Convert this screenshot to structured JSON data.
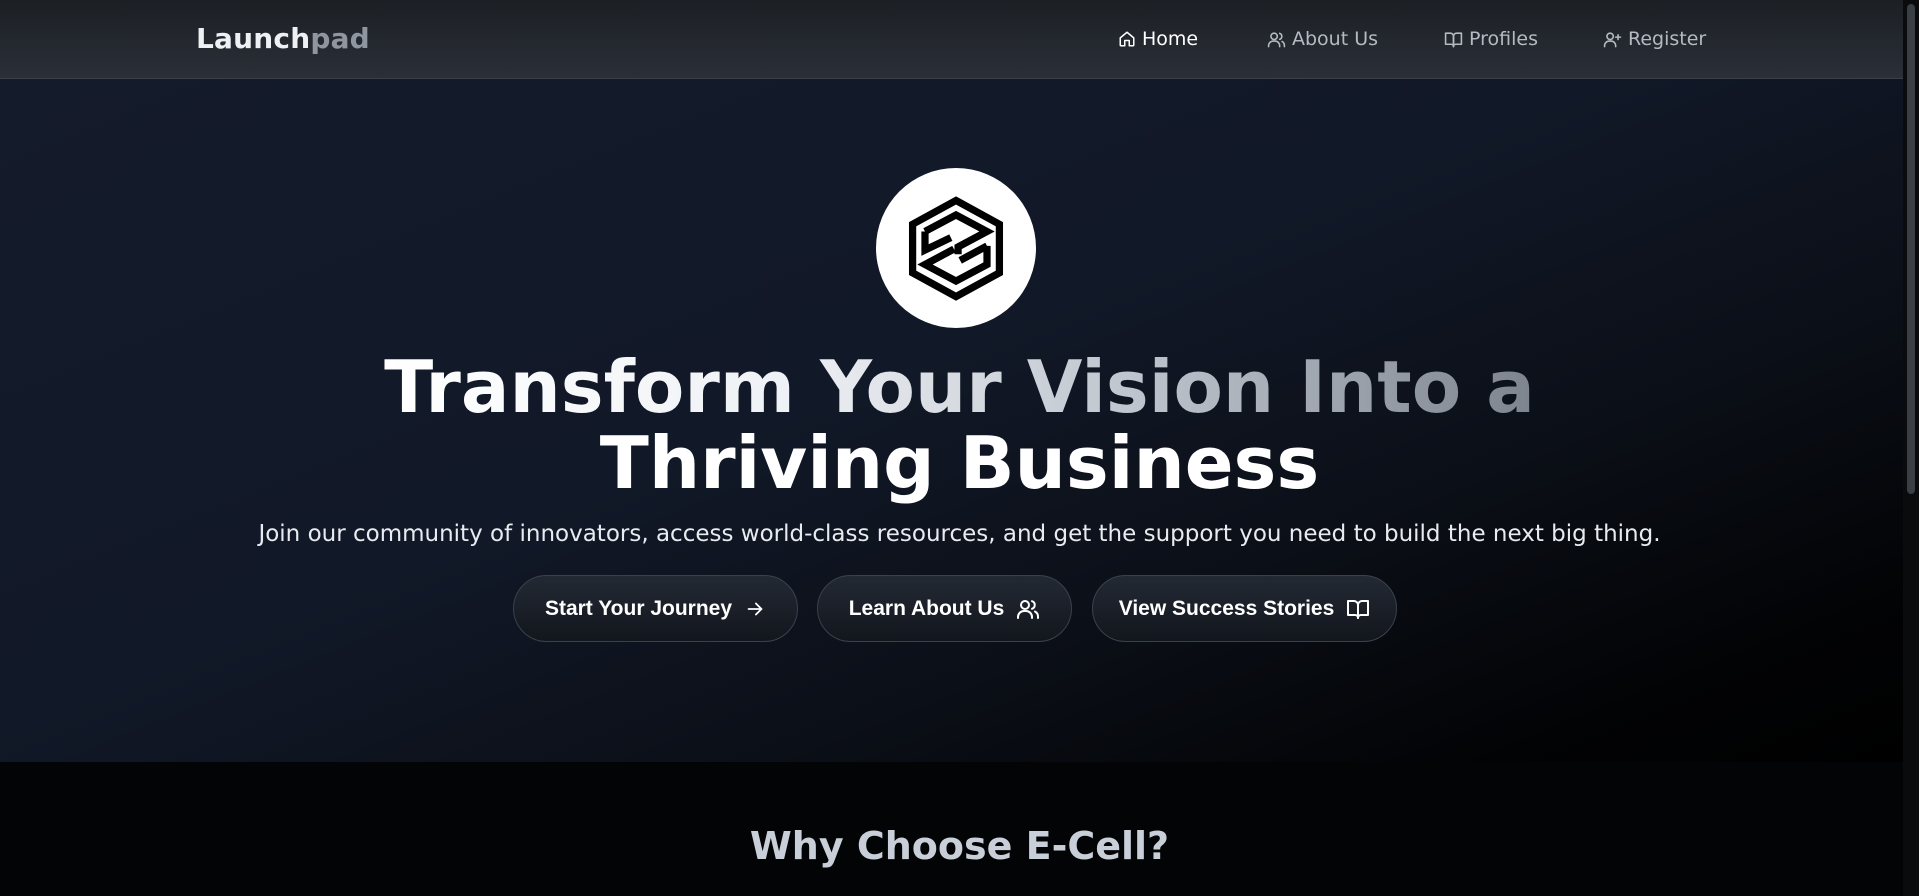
{
  "navbar": {
    "brand_part1": "Launch",
    "brand_part2": "pad",
    "items": [
      {
        "label": "Home",
        "icon": "home-icon",
        "active": true
      },
      {
        "label": "About Us",
        "icon": "users-icon",
        "active": false
      },
      {
        "label": "Profiles",
        "icon": "book-open-icon",
        "active": false
      },
      {
        "label": "Register",
        "icon": "user-plus-icon",
        "active": false
      }
    ]
  },
  "hero": {
    "logo_icon": "hexagon-z-logo",
    "headline_line1": "Transform Your Vision Into a",
    "headline_line2": "Thriving Business",
    "subtext": "Join our community of innovators, access world-class resources, and get the support you need to build the next big thing.",
    "buttons": [
      {
        "label": "Start Your Journey",
        "icon": "arrow-right-icon"
      },
      {
        "label": "Learn About Us",
        "icon": "users-icon"
      },
      {
        "label": "View Success Stories",
        "icon": "book-open-icon"
      }
    ]
  },
  "section": {
    "title": "Why Choose E-Cell?"
  },
  "colors": {
    "nav_bg": "#2a2f38",
    "hero_bg": "#111827",
    "text_primary": "#ffffff",
    "text_muted": "#b4bac3",
    "section_title": "#c9cfd8"
  }
}
